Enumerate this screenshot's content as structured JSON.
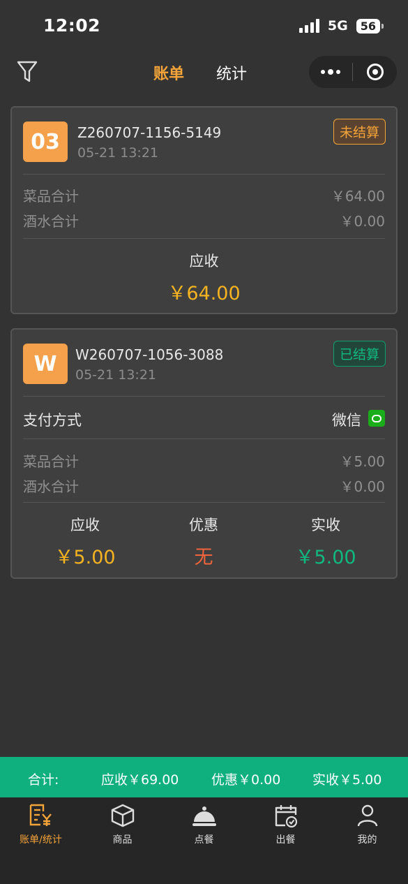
{
  "status_bar": {
    "time": "12:02",
    "network": "5G",
    "battery": "56"
  },
  "header": {
    "tabs": [
      {
        "label": "账单",
        "active": true
      },
      {
        "label": "统计",
        "active": false
      }
    ]
  },
  "orders": [
    {
      "badge_text": "03",
      "order_no": "Z260707-1156-5149",
      "time": "05-21 13:21",
      "status": "未结算",
      "rows": [
        {
          "label": "菜品合计",
          "value": "￥64.00"
        },
        {
          "label": "酒水合计",
          "value": "￥0.00"
        }
      ],
      "receivable_label": "应收",
      "receivable_value": "￥64.00"
    },
    {
      "badge_text": "W",
      "order_no": "W260707-1056-3088",
      "time": "05-21 13:21",
      "status": "已结算",
      "payment_label": "支付方式",
      "payment_value": "微信",
      "rows": [
        {
          "label": "菜品合计",
          "value": "￥5.00"
        },
        {
          "label": "酒水合计",
          "value": "￥0.00"
        }
      ],
      "columns": [
        {
          "label": "应收",
          "value": "￥5.00",
          "color": "#f5b321"
        },
        {
          "label": "优惠",
          "value": "无",
          "color": "#f0643c"
        },
        {
          "label": "实收",
          "value": "￥5.00",
          "color": "#10b981"
        }
      ]
    }
  ],
  "summary": {
    "label": "合计:",
    "receivable": "应收￥69.00",
    "discount": "优惠￥0.00",
    "actual": "实收￥5.00"
  },
  "tabbar": [
    {
      "label": "账单/统计",
      "icon": "bill-icon",
      "active": true
    },
    {
      "label": "商品",
      "icon": "box-icon",
      "active": false
    },
    {
      "label": "点餐",
      "icon": "dish-cover-icon",
      "active": false
    },
    {
      "label": "出餐",
      "icon": "calendar-check-icon",
      "active": false
    },
    {
      "label": "我的",
      "icon": "user-icon",
      "active": false
    }
  ],
  "colors": {
    "accent": "#f5a43a",
    "paid": "#10b981",
    "summary_bg": "#0faf7e"
  }
}
